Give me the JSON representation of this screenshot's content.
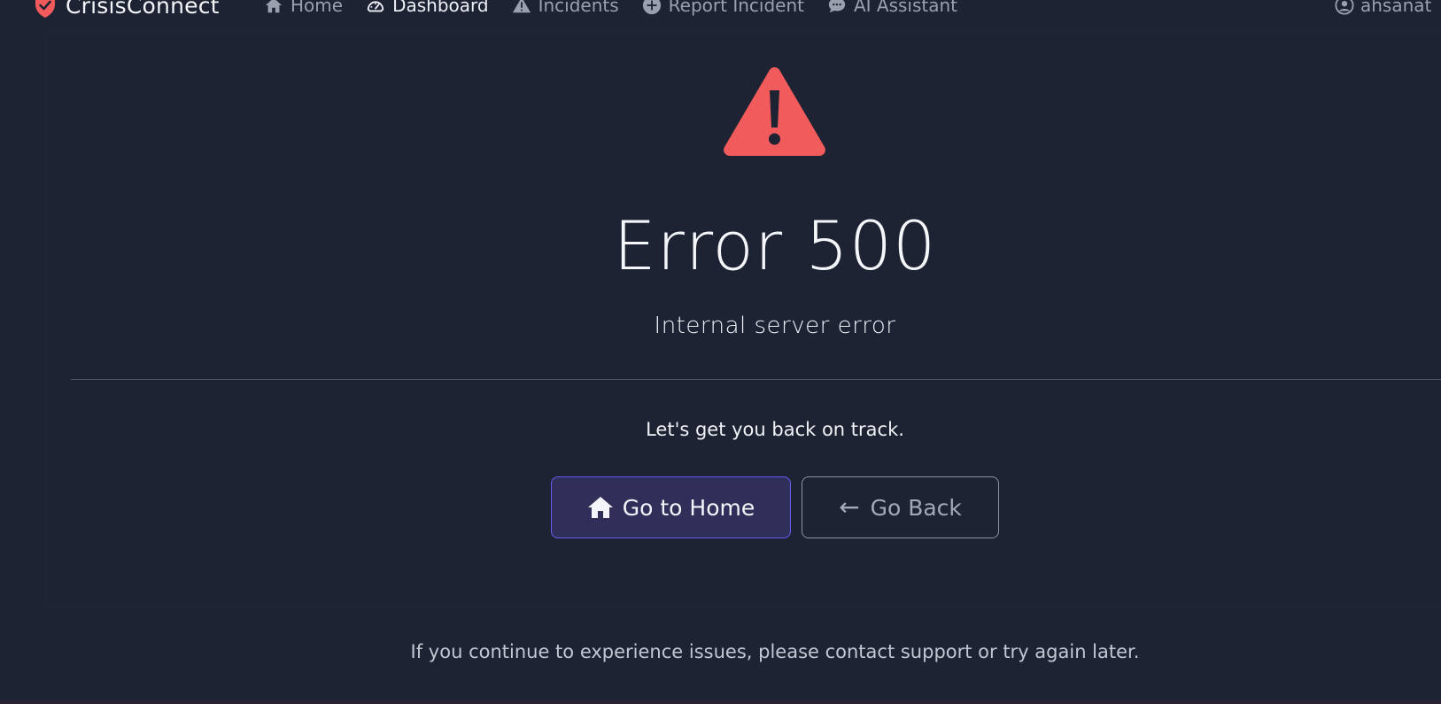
{
  "brand": {
    "name": "CrisisConnect",
    "icon": "shield-check-icon",
    "icon_color": "#f25b5b"
  },
  "nav": {
    "items": [
      {
        "label": "Home",
        "icon": "home-icon",
        "active": false
      },
      {
        "label": "Dashboard",
        "icon": "gauge-icon",
        "active": true
      },
      {
        "label": "Incidents",
        "icon": "warning-icon",
        "active": false
      },
      {
        "label": "Report Incident",
        "icon": "plus-circle-icon",
        "active": false
      },
      {
        "label": "AI Assistant",
        "icon": "chat-icon",
        "active": false
      }
    ],
    "user": {
      "label": "ahsanat",
      "icon": "user-circle-icon"
    }
  },
  "error": {
    "icon": "warning-triangle-icon",
    "icon_color": "#f25b5b",
    "title": "Error 500",
    "subtitle": "Internal server error",
    "message": "Let's get you back on track."
  },
  "actions": {
    "home_label": "Go to Home",
    "home_icon": "home-icon",
    "back_arrow": "←",
    "back_label": "Go Back"
  },
  "footer": {
    "text": "If you continue to experience issues, please contact support or try again later."
  },
  "colors": {
    "background": "#1e2334",
    "accent": "#6a5cf0",
    "danger": "#f25b5b"
  }
}
